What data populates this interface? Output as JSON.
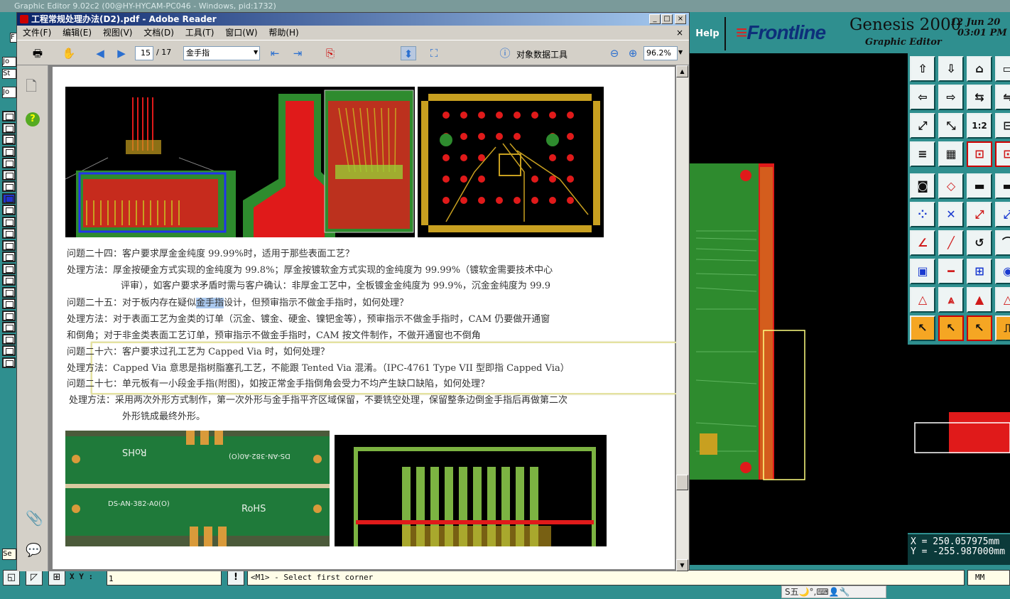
{
  "outer_window": {
    "title": "Graphic Editor 9.02c2 (00@HY-HYCAM-PC046 - Windows, pid:1732)"
  },
  "adobe": {
    "title": "工程常规处理办法(D2).pdf - Adobe Reader",
    "window_buttons": [
      "_",
      "□",
      "×"
    ],
    "menu": [
      "文件(F)",
      "编辑(E)",
      "视图(V)",
      "文档(D)",
      "工具(T)",
      "窗口(W)",
      "帮助(H)"
    ],
    "menu_close": "×",
    "toolbar": {
      "page_current": "15",
      "page_total": "/ 17",
      "search_value": "金手指",
      "object_data_tool": "对象数据工具",
      "zoom": "96.2%"
    },
    "document": {
      "lines": [
        {
          "id": "q24",
          "text": "问题二十四：客户要求厚金金纯度 99.99%时，适用于那些表面工艺？"
        },
        {
          "id": "a24a",
          "text": "处理方法：厚金按硬金方式实现的金纯度为 99.8%；厚金按镀软金方式实现的金纯度为 99.99%（镀软金需要技术中心"
        },
        {
          "id": "a24b",
          "text": "评审），如客户要求矛盾时需与客户确认：非厚金工艺中，全板镀金金纯度为 99.9%，沉金金纯度为 99.9"
        },
        {
          "id": "q25_pre",
          "text": "问题二十五：对于板内存在疑似"
        },
        {
          "id": "q25_sel",
          "text": "金手指"
        },
        {
          "id": "q25_post",
          "text": "设计，但预审指示不做金手指时，如何处理？"
        },
        {
          "id": "a25a",
          "text": "处理方法：对于表面工艺为金类的订单（沉金、镀金、硬金、镍钯金等），预审指示不做金手指时，CAM 仍要做开通窗"
        },
        {
          "id": "a25b",
          "text": "和倒角；对于非金类表面工艺订单，预审指示不做金手指时，CAM 按文件制作，不做开通窗也不倒角"
        },
        {
          "id": "q26",
          "text": "问题二十六：客户要求过孔工艺为 Capped Via 时，如何处理？"
        },
        {
          "id": "a26",
          "text": "处理方法：Capped Via 意思是指树脂塞孔工艺，不能跟 Tented Via 混淆。（IPC-4761 Type VII 型即指 Capped Via）"
        },
        {
          "id": "q27",
          "text": "问题二十七：单元板有一小段金手指(附图)，如按正常金手指倒角会受力不均产生缺口缺陷，如何处理？"
        },
        {
          "id": "a27a",
          "text": "处理方法：采用两次外形方式制作，第一次外形与金手指平齐区域保留，不要铣空处理，保留整条边倒金手指后再做第二次"
        },
        {
          "id": "a27b",
          "text": "外形铣成最终外形。"
        }
      ],
      "photo_text": [
        "RoHS",
        "DS-AN-382-A0(O)",
        "DS-AN-382-A0(O)",
        "RoHS"
      ]
    }
  },
  "genesis": {
    "help": "Help",
    "brand": "Frontline",
    "product": "Genesis 2000",
    "subtitle": "Graphic Editor",
    "date": "12 Jun 20",
    "time": "03:01 PM",
    "coord_x": "X = 250.057975mm",
    "coord_y": "Y = -255.987000mm",
    "xy_label": "X Y :",
    "status_value": "1",
    "message": "<M1> - Select first corner",
    "exclaim": "!",
    "units": "MM",
    "ime": "S五🌙°,⌨👤🔧",
    "left_tabs": [
      "Jo",
      "St",
      "Jo",
      "F",
      "Se"
    ]
  },
  "colors": {
    "pcb_green": "#2e8b2e",
    "pcb_red": "#e01a1a",
    "gold": "#c8a020",
    "teal": "#2f8f8f",
    "highlight_box": "#e4e2a0",
    "selection": "#aac8ee"
  }
}
